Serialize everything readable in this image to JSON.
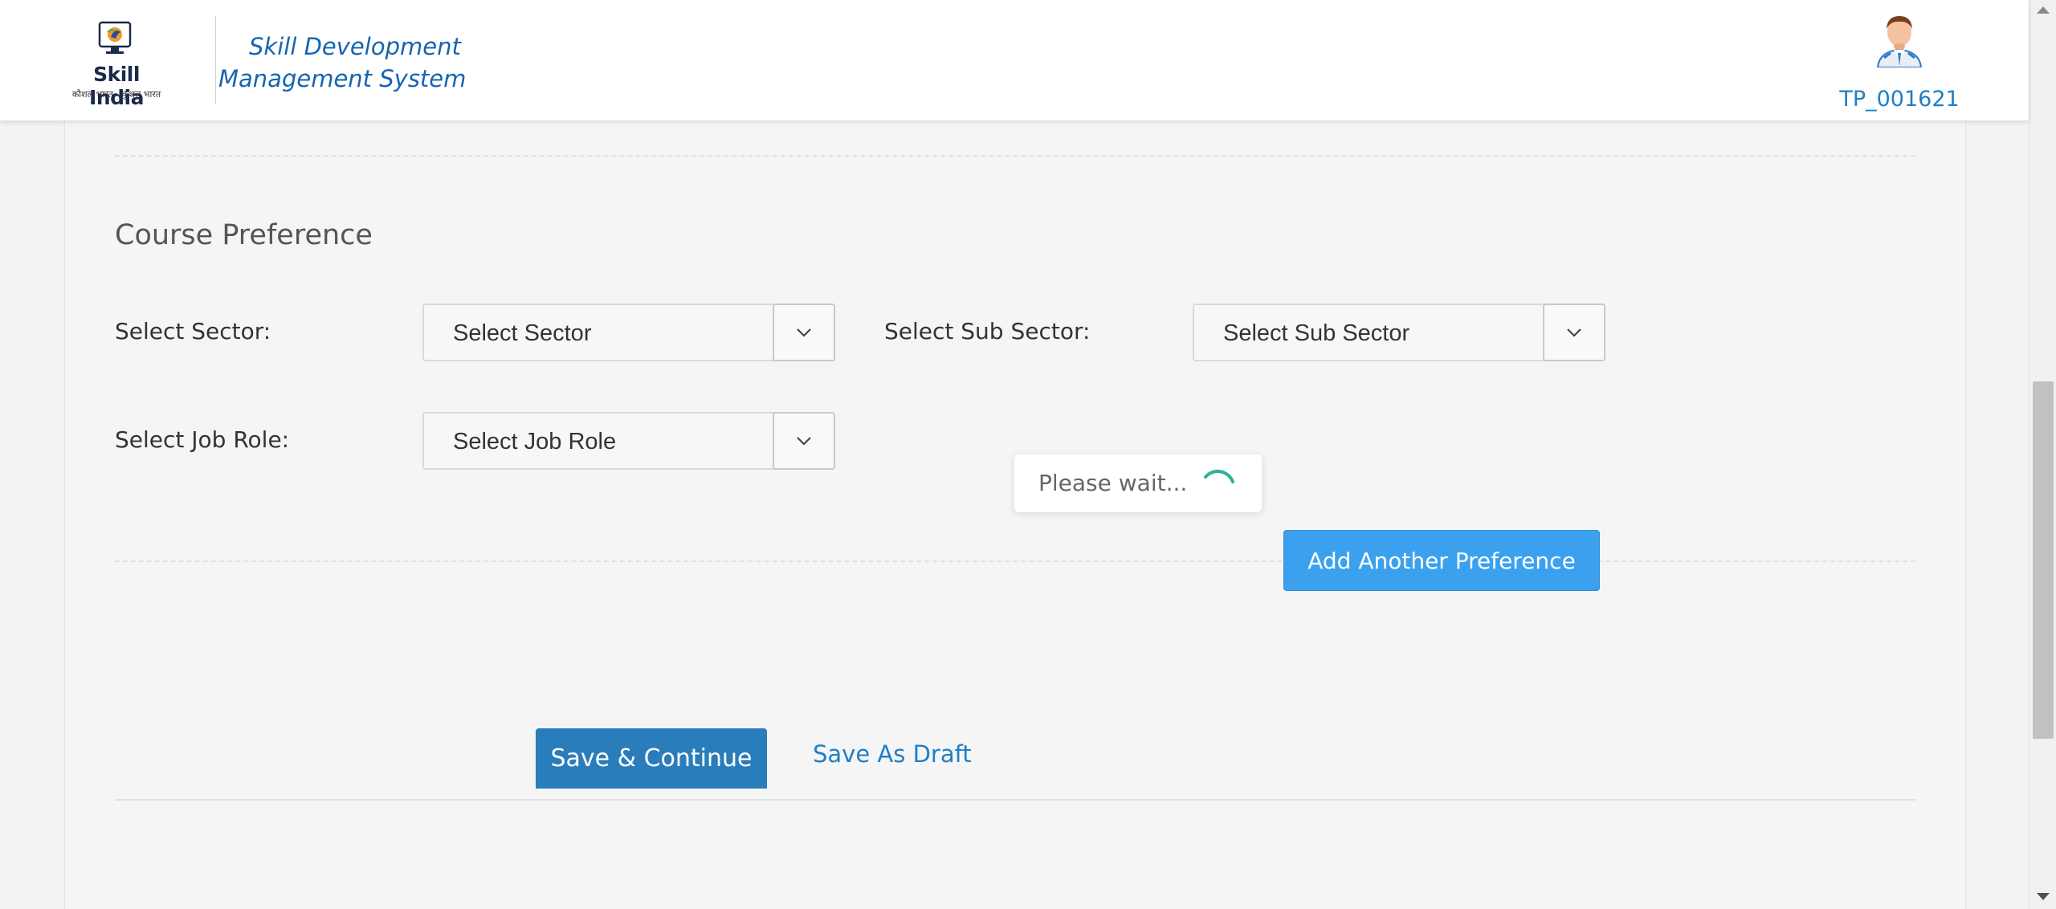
{
  "header": {
    "logo_text": "Skill India",
    "logo_tagline": "कौशल भारत - कुशल भारत",
    "app_title": "Skill Development Management System",
    "user_id": "TP_001621"
  },
  "course_preference": {
    "section_title": "Course Preference",
    "sector": {
      "label": "Select Sector:",
      "value": "Select Sector"
    },
    "sub_sector": {
      "label": "Select Sub Sector:",
      "value": "Select Sub Sector"
    },
    "job_role": {
      "label": "Select Job Role:",
      "value": "Select Job Role"
    },
    "add_preference_label": "Add Another Preference"
  },
  "loading": {
    "text": "Please wait..."
  },
  "footer_actions": {
    "save_continue_label": "Save & Continue",
    "save_draft_label": "Save As Draft"
  },
  "colors": {
    "brand_blue": "#1565b0",
    "primary_button": "#2a7dbb",
    "secondary_button": "#3ba1ef",
    "spinner": "#2bb39a"
  },
  "icons": {
    "dropdown": "chevron-down-icon",
    "avatar": "user-avatar-icon",
    "loading": "spinner-icon"
  }
}
